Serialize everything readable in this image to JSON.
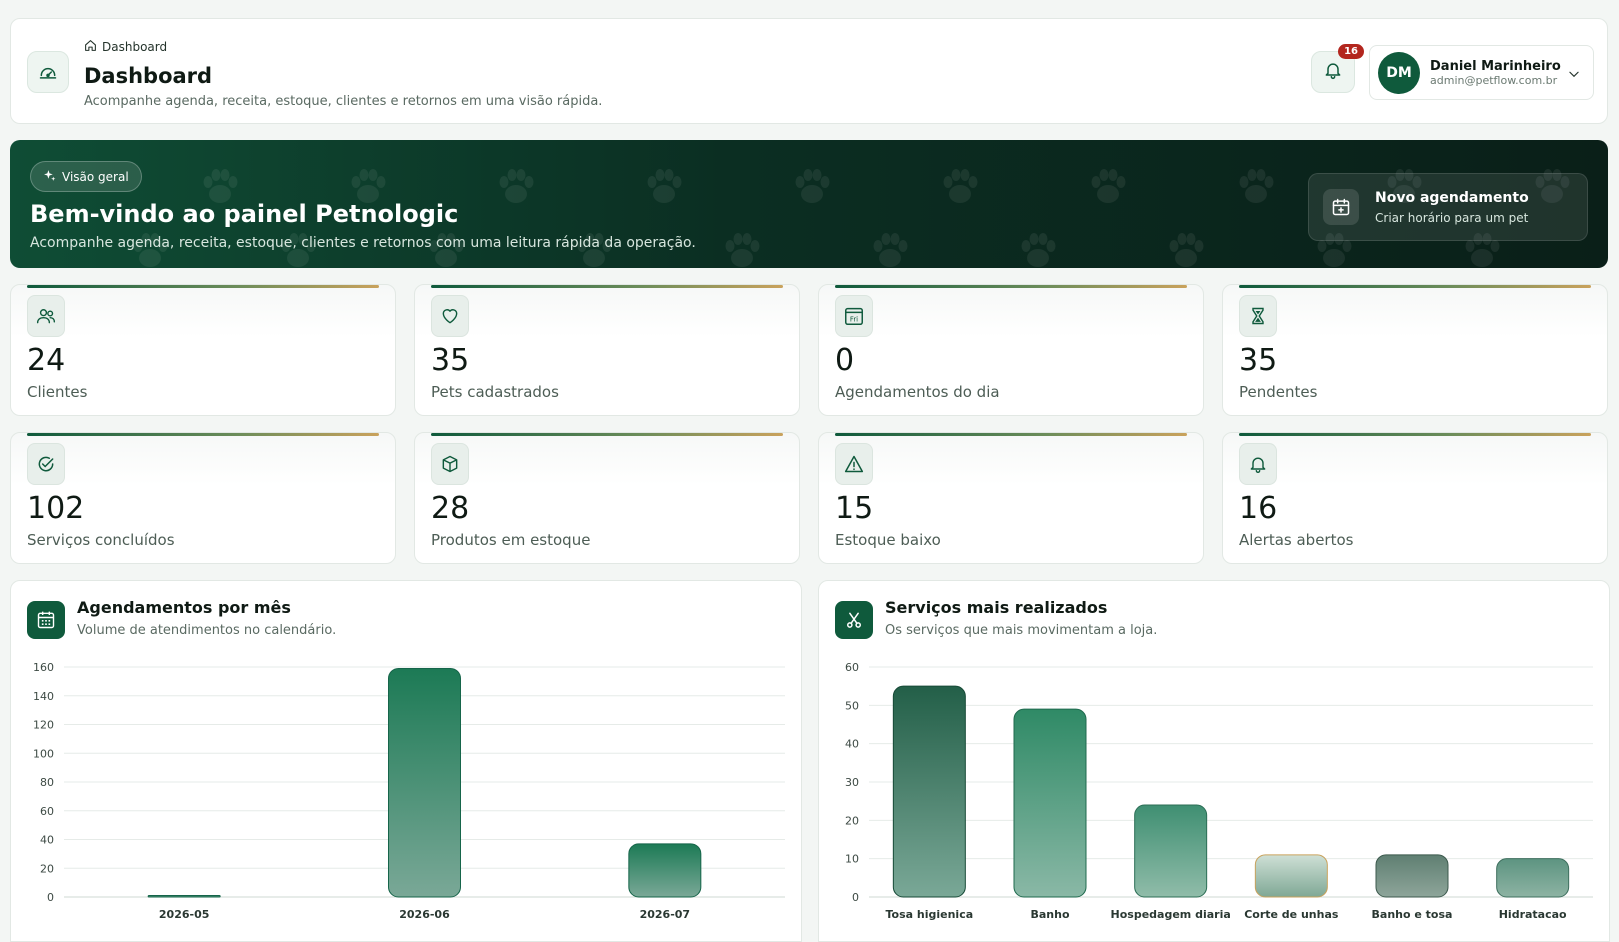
{
  "header": {
    "breadcrumb": "Dashboard",
    "title": "Dashboard",
    "subtitle": "Acompanhe agenda, receita, estoque, clientes e retornos em uma visão rápida.",
    "notifications_count": "16",
    "user": {
      "initials": "DM",
      "name": "Daniel Marinheiro",
      "email": "admin@petflow.com.br"
    }
  },
  "banner": {
    "pill": "Visão geral",
    "title": "Bem-vindo ao painel Petnologic",
    "subtitle": "Acompanhe agenda, receita, estoque, clientes e retornos com uma leitura rápida da operação.",
    "cta_title": "Novo agendamento",
    "cta_sub": "Criar horário para um pet"
  },
  "stats": [
    {
      "value": "24",
      "label": "Clientes",
      "icon": "users-icon"
    },
    {
      "value": "35",
      "label": "Pets cadastrados",
      "icon": "heart-icon"
    },
    {
      "value": "0",
      "label": "Agendamentos do dia",
      "icon": "calendar-day-icon",
      "icon_text": "Fri"
    },
    {
      "value": "35",
      "label": "Pendentes",
      "icon": "hourglass-icon"
    },
    {
      "value": "102",
      "label": "Serviços concluídos",
      "icon": "check-circle-icon"
    },
    {
      "value": "28",
      "label": "Produtos em estoque",
      "icon": "box-icon"
    },
    {
      "value": "15",
      "label": "Estoque baixo",
      "icon": "warning-icon"
    },
    {
      "value": "16",
      "label": "Alertas abertos",
      "icon": "bell-icon"
    }
  ],
  "colors": {
    "primary": "#0f5a3c",
    "accent_gold": "#c9a25c",
    "badge_red": "#b3261e"
  },
  "chart_data": [
    {
      "type": "bar",
      "title": "Agendamentos por mês",
      "subtitle": "Volume de atendimentos no calendário.",
      "categories": [
        "2026-05",
        "2026-06",
        "2026-07"
      ],
      "values": [
        1,
        159,
        37
      ],
      "ylim": [
        0,
        160
      ],
      "yticks": [
        "0",
        "20",
        "40",
        "60",
        "80",
        "100",
        "120",
        "140",
        "160"
      ],
      "grid": true
    },
    {
      "type": "bar",
      "title": "Serviços mais realizados",
      "subtitle": "Os serviços que mais movimentam a loja.",
      "categories": [
        "Tosa higienica",
        "Banho",
        "Hospedagem diaria",
        "Corte de unhas",
        "Banho e tosa",
        "Hidratacao"
      ],
      "values": [
        55,
        49,
        24,
        11,
        11,
        10
      ],
      "ylim": [
        0,
        60
      ],
      "yticks": [
        "0",
        "10",
        "20",
        "30",
        "40",
        "50",
        "60"
      ],
      "grid": true
    }
  ]
}
